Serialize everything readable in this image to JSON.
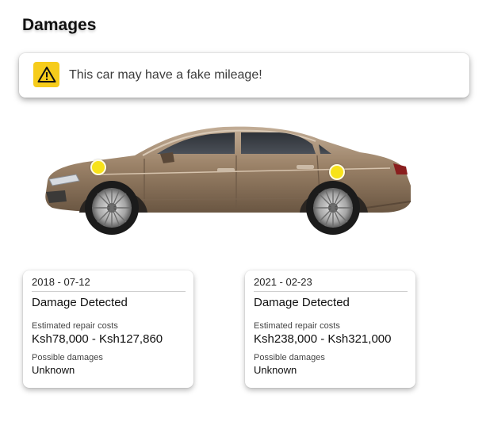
{
  "page": {
    "title": "Damages"
  },
  "alert": {
    "text": "This car may have a fake mileage!",
    "icon": "warning-icon",
    "icon_color": "#f6cc1b"
  },
  "vehicle": {
    "image": "sedan-side-view",
    "marker_color": "#f7e21a",
    "markers": [
      "front-wheel-arch",
      "rear-wheel-arch"
    ]
  },
  "damages": [
    {
      "date": "2018 - 07-12",
      "status": "Damage Detected",
      "cost_label": "Estimated repair costs",
      "cost_range": "Ksh78,000 - Ksh127,860",
      "possible_label": "Possible damages",
      "possible_value": "Unknown"
    },
    {
      "date": "2021 - 02-23",
      "status": "Damage Detected",
      "cost_label": "Estimated repair costs",
      "cost_range": "Ksh238,000 - Ksh321,000",
      "possible_label": "Possible damages",
      "possible_value": "Unknown"
    }
  ]
}
